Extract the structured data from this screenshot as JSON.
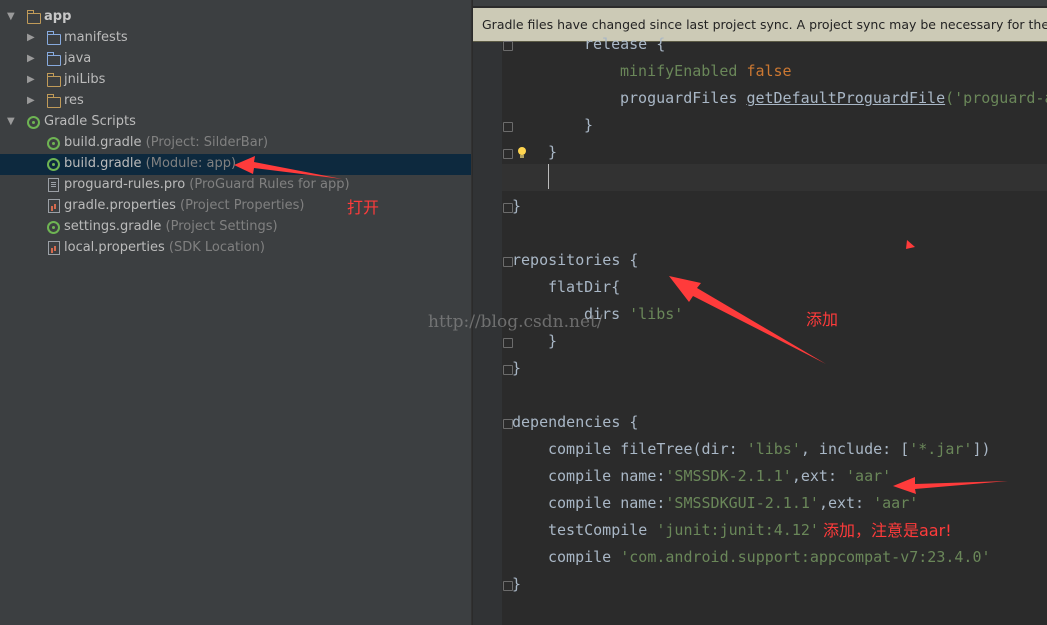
{
  "project_tree": {
    "root": "app",
    "folders": [
      "manifests",
      "java",
      "jniLibs",
      "res"
    ],
    "scripts_label": "Gradle Scripts",
    "files": [
      {
        "name": "build.gradle",
        "hint": "(Project: SilderBar)"
      },
      {
        "name": "build.gradle",
        "hint": "(Module: app)"
      },
      {
        "name": "proguard-rules.pro",
        "hint": "(ProGuard Rules for app)"
      },
      {
        "name": "gradle.properties",
        "hint": "(Project Properties)"
      },
      {
        "name": "settings.gradle",
        "hint": "(Project Settings)"
      },
      {
        "name": "local.properties",
        "hint": "(SDK Location)"
      }
    ]
  },
  "banner": {
    "text": "Gradle files have changed since last project sync. A project sync may be necessary for the IDE to"
  },
  "code": {
    "release": "release {",
    "minify_key": "minifyEnabled",
    "minify_val": "false",
    "proguard_key": "proguardFiles",
    "proguard_fn": "getDefaultProguardFile",
    "proguard_arg": "('proguard-a",
    "brace_close": "}",
    "brace_open": " {",
    "repositories": "repositories",
    "flatdir": "flatDir{",
    "dirs": "dirs",
    "dirs_val": "'libs'",
    "dependencies": "dependencies",
    "compile": "compile",
    "filetree_call": "fileTree(",
    "dir_label": "dir: ",
    "libs_str": "'libs'",
    "include_label": ", include: [",
    "jar_str": "'*.jar'",
    "filetree_end": "])",
    "name_label": "name:",
    "smssdk": "'SMSSDK-2.1.1'",
    "ext_label": ",ext: ",
    "aar": "'aar'",
    "smssdkgui": "'SMSSDKGUI-2.1.1'",
    "test_compile": "testCompile",
    "junit": "'junit:junit:4.12'",
    "appcompat": "'com.android.support:appcompat-v7:23.4.0'"
  },
  "annotations": {
    "open": "打开",
    "add": "添加",
    "add_note": "添加，注意是aar!"
  },
  "watermark": "http://blog.csdn.net/",
  "colors": {
    "annotation": "#ff3b3b",
    "keyword": "#cc7832",
    "string": "#6a8759",
    "selection": "#0d293e"
  }
}
